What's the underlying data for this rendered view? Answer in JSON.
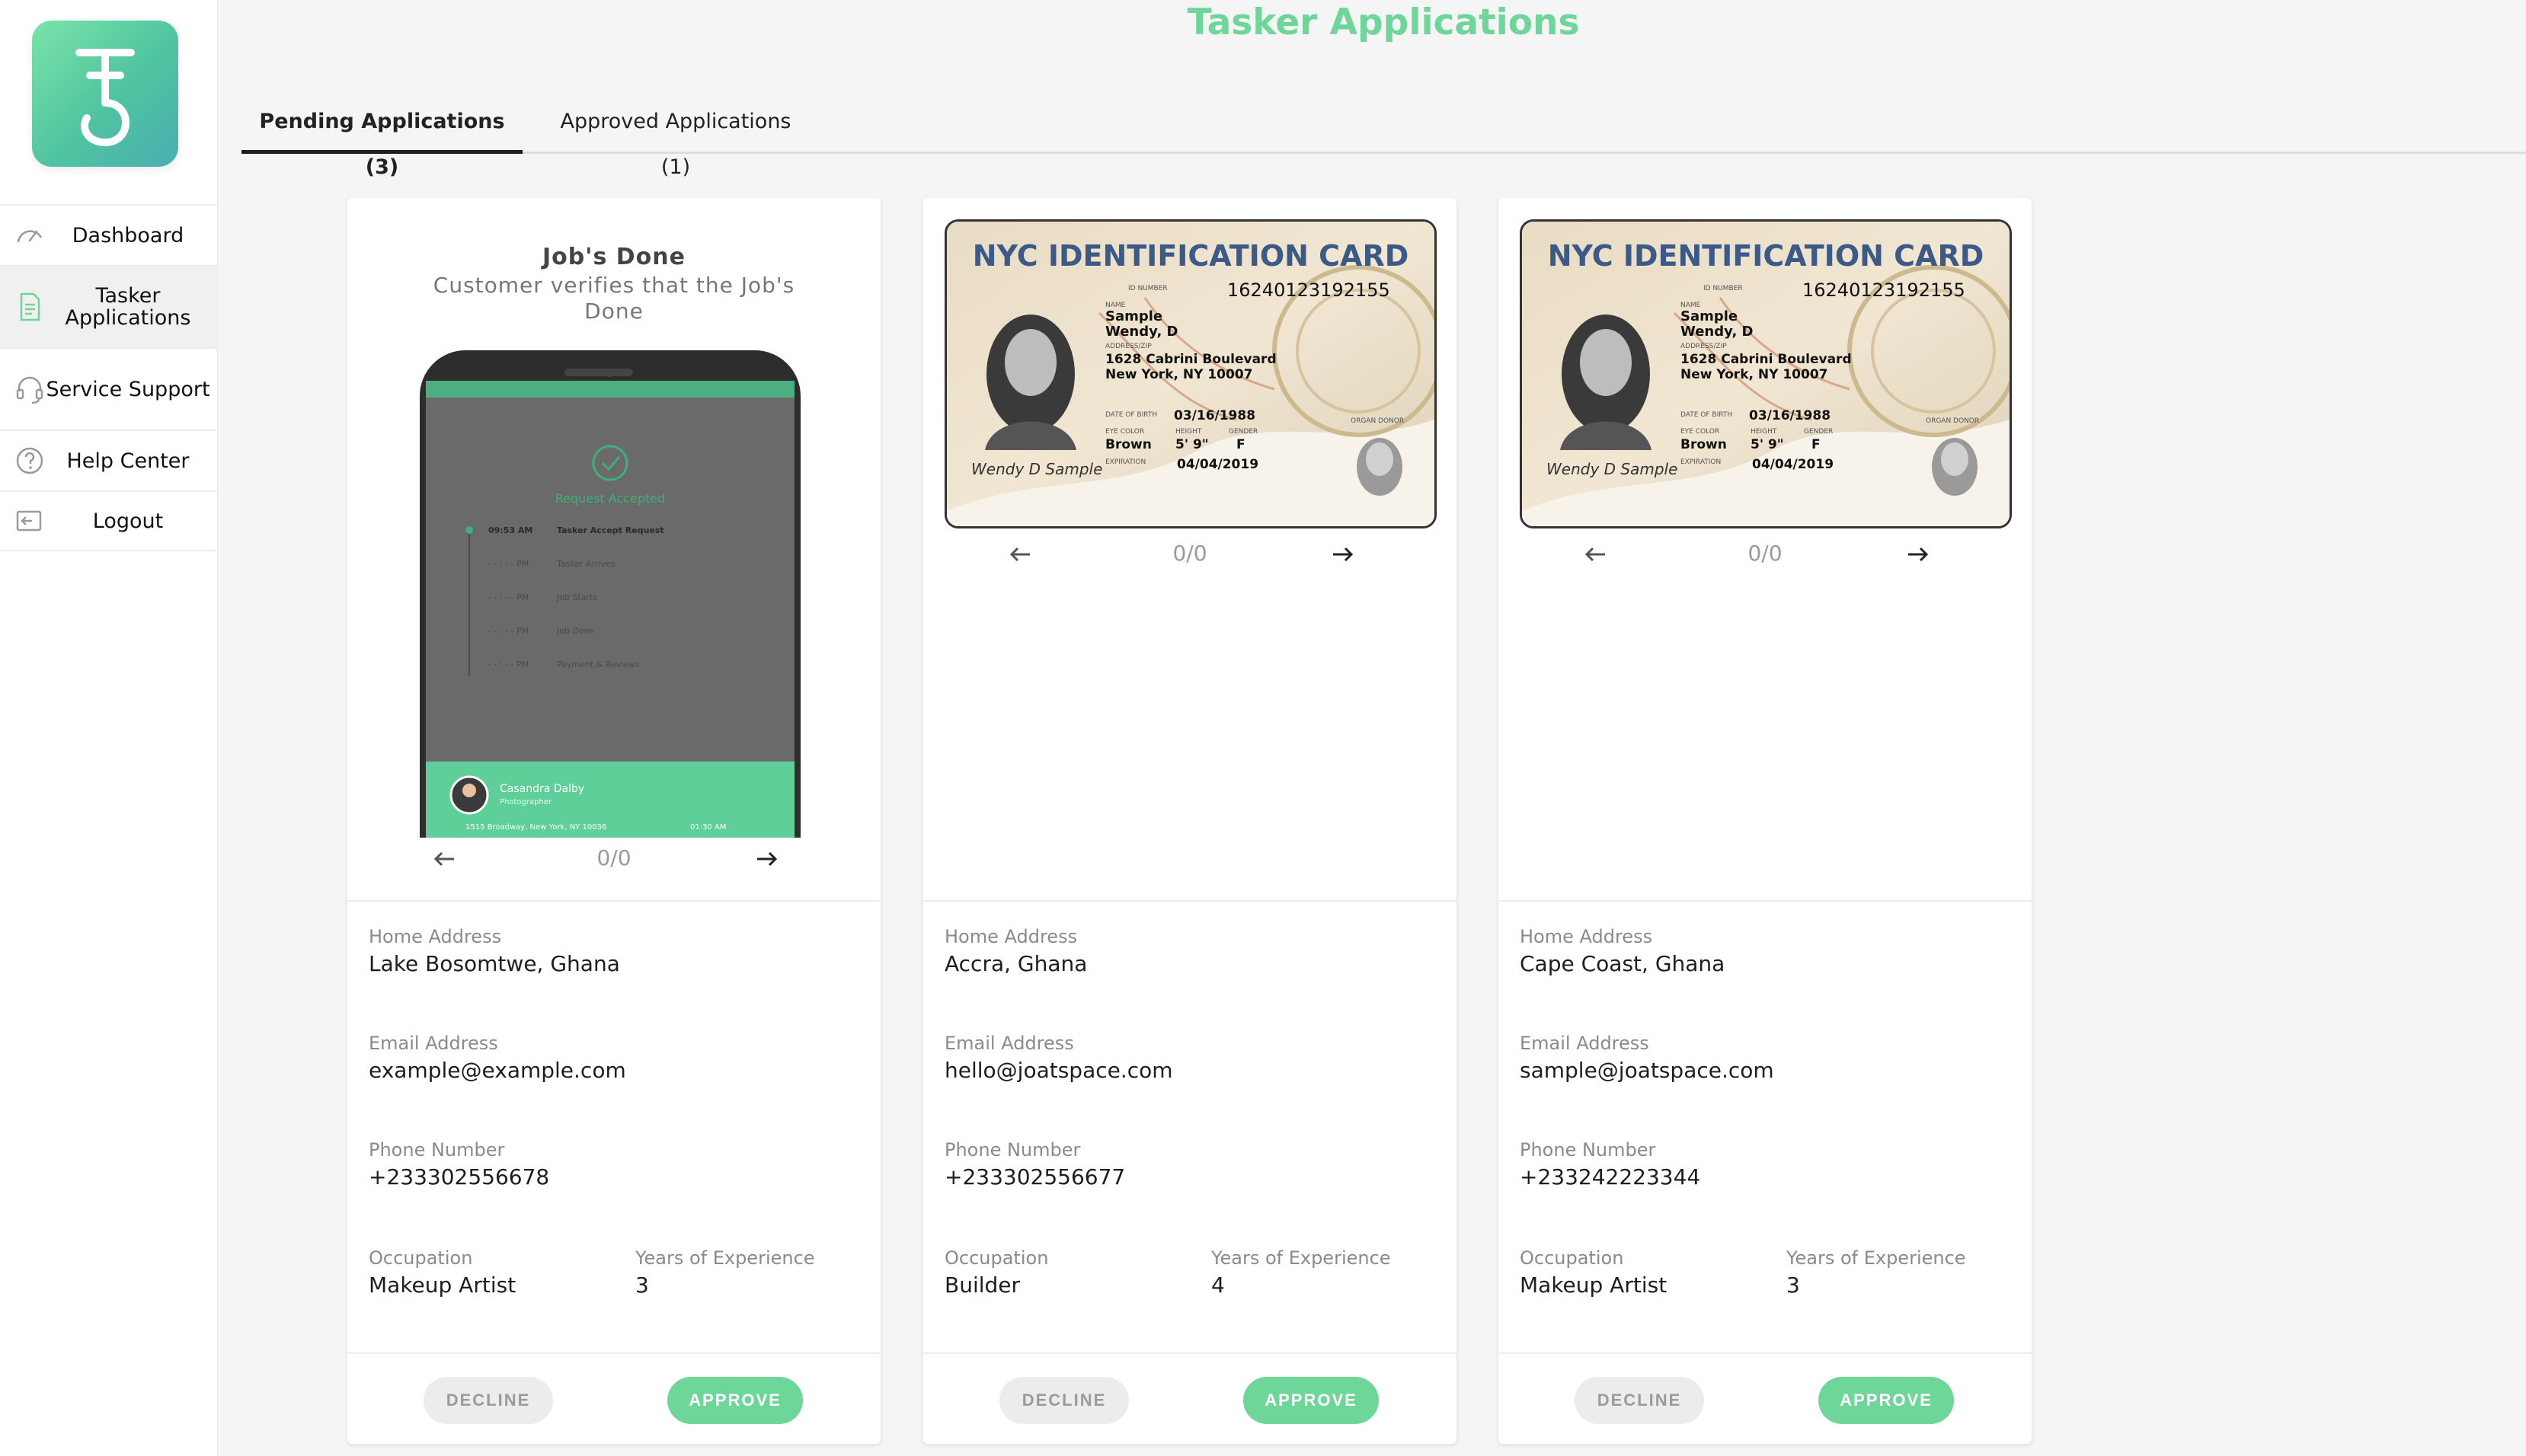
{
  "app": {
    "logo_icon": "tasker-hook-logo",
    "accent": "#6fd69a"
  },
  "sidebar": {
    "items": [
      {
        "label": "Dashboard",
        "icon": "gauge-icon",
        "active": false
      },
      {
        "label": "Tasker Applications",
        "icon": "document-icon",
        "active": true
      },
      {
        "label": "Service Support",
        "icon": "headset-icon",
        "active": false
      },
      {
        "label": "Help Center",
        "icon": "question-icon",
        "active": false
      },
      {
        "label": "Logout",
        "icon": "logout-icon",
        "active": false
      }
    ]
  },
  "header": {
    "title": "Tasker Applications"
  },
  "tabs": [
    {
      "label": "Pending Applications (3)",
      "active": true
    },
    {
      "label": "Approved Applications (1)",
      "active": false
    }
  ],
  "labels": {
    "home_address": "Home Address",
    "email_address": "Email Address",
    "phone_number": "Phone Number",
    "occupation": "Occupation",
    "years_of_experience": "Years of Experience",
    "decline": "DECLINE",
    "approve": "APPROVE"
  },
  "slide": {
    "title": "Job's Done",
    "subtitle": "Customer verifies that the Job's Done",
    "screen": {
      "status": "Request Accepted",
      "timeline": [
        {
          "time": "09:53 AM",
          "event": "Tasker Accept Request"
        },
        {
          "time": "- - : - - PM",
          "event": "Tasker Arrives"
        },
        {
          "time": "- - : - - PM",
          "event": "Job Starts"
        },
        {
          "time": "- - : - - PM",
          "event": "Job Done"
        },
        {
          "time": "- - : - - PM",
          "event": "Payment & Reviews"
        }
      ],
      "customer_name": "Casandra Dalby",
      "customer_role": "Photographer",
      "address": "1515 Broadway, New York, NY 10036",
      "time": "01:30 AM"
    }
  },
  "id_card": {
    "title": "NYC IDENTIFICATION CARD",
    "id_label": "ID NUMBER",
    "id_number": "16240123192155",
    "name_label": "NAME",
    "name_line1": "Sample",
    "name_line2": "Wendy, D",
    "address_label": "ADDRESS/ZIP",
    "address_line1": "1628 Cabrini Boulevard",
    "address_line2": "New York, NY 10007",
    "dob_label": "DATE OF BIRTH",
    "dob": "03/16/1988",
    "eye_label": "EYE COLOR",
    "eye": "Brown",
    "height_label": "HEIGHT",
    "height": "5' 9\"",
    "gender_label": "GENDER",
    "gender": "F",
    "exp_label": "EXPIRATION",
    "expiration": "04/04/2019",
    "donor_label": "ORGAN DONOR",
    "signature": "Wendy D Sample"
  },
  "applications": [
    {
      "media": "app-screenshot",
      "pager": "0/0",
      "address": "Lake Bosomtwe, Ghana",
      "email": "example@example.com",
      "phone": "+233302556678",
      "occupation": "Makeup Artist",
      "years": "3"
    },
    {
      "media": "id-card",
      "pager": "0/0",
      "address": "Accra, Ghana",
      "email": "hello@joatspace.com",
      "phone": "+233302556677",
      "occupation": "Builder",
      "years": "4"
    },
    {
      "media": "id-card",
      "pager": "0/0",
      "address": "Cape Coast, Ghana",
      "email": "sample@joatspace.com",
      "phone": "+233242223344",
      "occupation": "Makeup Artist",
      "years": "3"
    }
  ]
}
